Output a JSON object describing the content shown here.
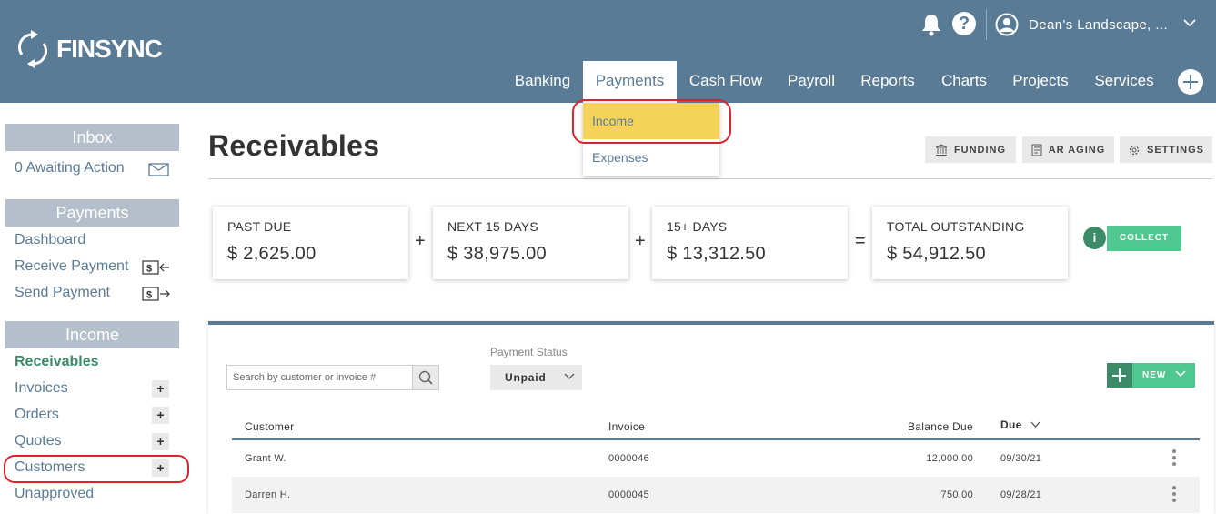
{
  "brand": {
    "name": "FINSYNC"
  },
  "header": {
    "account_name": "Dean's Landscape, ...",
    "help_glyph": "?",
    "nav": [
      {
        "label": "Banking"
      },
      {
        "label": "Payments"
      },
      {
        "label": "Cash Flow"
      },
      {
        "label": "Payroll"
      },
      {
        "label": "Reports"
      },
      {
        "label": "Charts"
      },
      {
        "label": "Projects"
      },
      {
        "label": "Services"
      }
    ],
    "active_nav": "Payments"
  },
  "payments_dropdown": {
    "items": [
      {
        "label": "Income"
      },
      {
        "label": "Expenses"
      }
    ],
    "highlighted": "Income"
  },
  "sidebar": {
    "inbox": {
      "heading": "Inbox",
      "items": [
        {
          "label": "0 Awaiting Action",
          "icon": "mail-icon"
        }
      ]
    },
    "payments": {
      "heading": "Payments",
      "items": [
        {
          "label": "Dashboard"
        },
        {
          "label": "Receive Payment",
          "icon": "receive-money-icon"
        },
        {
          "label": "Send Payment",
          "icon": "send-money-icon"
        }
      ]
    },
    "income": {
      "heading": "Income",
      "items": [
        {
          "label": "Receivables",
          "active": true
        },
        {
          "label": "Invoices",
          "plus": "+"
        },
        {
          "label": "Orders",
          "plus": "+"
        },
        {
          "label": "Quotes",
          "plus": "+"
        },
        {
          "label": "Customers",
          "plus": "+"
        },
        {
          "label": "Unapproved"
        }
      ]
    }
  },
  "page": {
    "title": "Receivables",
    "header_buttons": [
      {
        "label": "FUNDING",
        "icon": "bank-icon"
      },
      {
        "label": "AR AGING",
        "icon": "report-icon"
      },
      {
        "label": "SETTINGS",
        "icon": "gear-icon"
      }
    ]
  },
  "summary": {
    "cards": [
      {
        "label": "PAST DUE",
        "value": "$ 2,625.00"
      },
      {
        "label": "NEXT 15 DAYS",
        "value": "$ 38,975.00"
      },
      {
        "label": "15+ DAYS",
        "value": "$ 13,312.50"
      },
      {
        "label": "TOTAL OUTSTANDING",
        "value": "$ 54,912.50"
      }
    ],
    "operators": [
      "+",
      "+",
      "="
    ],
    "info_glyph": "i",
    "collect_label": "COLLECT"
  },
  "table": {
    "search_placeholder": "Search by customer or invoice #",
    "status_label": "Payment Status",
    "status_value": "Unpaid",
    "new_label": "NEW",
    "columns": [
      "Customer",
      "Invoice",
      "Balance Due",
      "Due"
    ],
    "sort_column": "Due",
    "rows": [
      {
        "customer": "Grant W.",
        "invoice": "0000046",
        "balance": "12,000.00",
        "due": "09/30/21"
      },
      {
        "customer": "Darren H.",
        "invoice": "0000045",
        "balance": "750.00",
        "due": "09/28/21"
      }
    ]
  },
  "colors": {
    "header": "#5a7b96",
    "accent_green": "#4fc88f",
    "dark_green": "#3c8a68",
    "highlight_yellow": "#f5d258",
    "annotation_red": "#e0202a"
  }
}
